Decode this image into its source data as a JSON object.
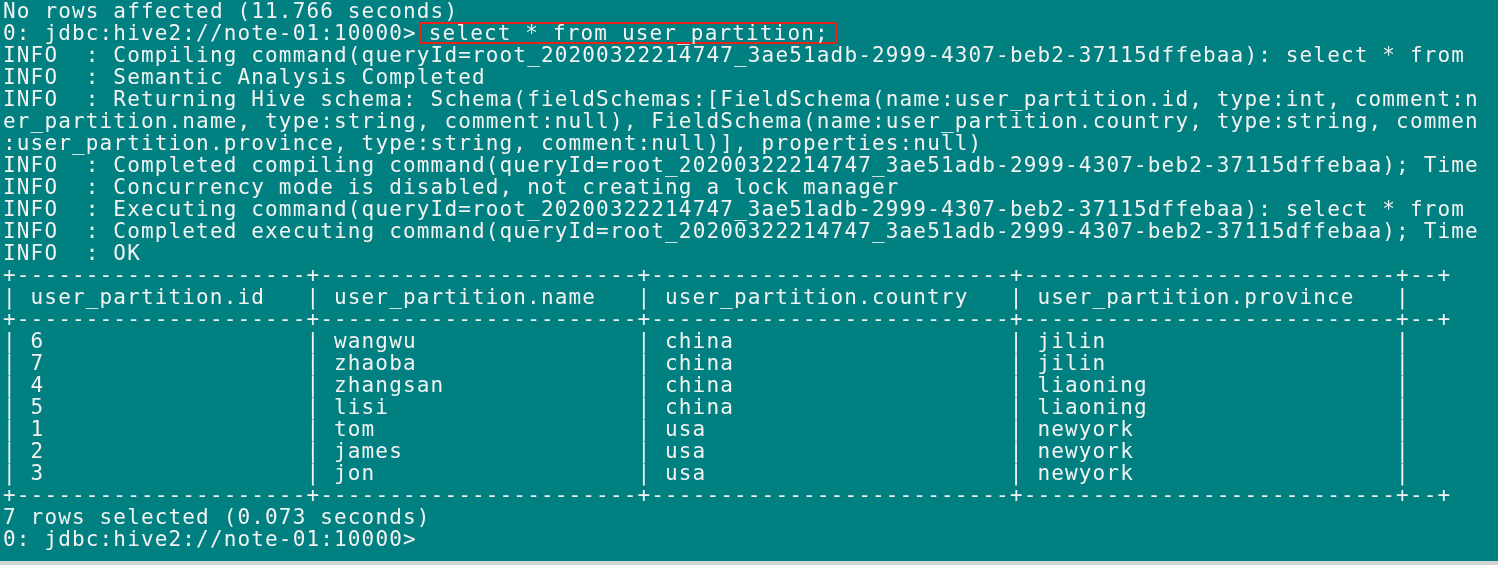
{
  "terminal": {
    "lines": [
      {
        "kind": "output",
        "text": "No rows affected (11.766 seconds)"
      },
      {
        "kind": "prompt",
        "prompt": "0: jdbc:hive2://note-01:10000>",
        "command": "select * from user_partition;",
        "highlighted": true
      },
      {
        "kind": "output",
        "text": "INFO  : Compiling command(queryId=root_20200322214747_3ae51adb-2999-4307-beb2-37115dffebaa): select * from"
      },
      {
        "kind": "output",
        "text": "INFO  : Semantic Analysis Completed"
      },
      {
        "kind": "output",
        "text": "INFO  : Returning Hive schema: Schema(fieldSchemas:[FieldSchema(name:user_partition.id, type:int, comment:n"
      },
      {
        "kind": "output",
        "text": "er_partition.name, type:string, comment:null), FieldSchema(name:user_partition.country, type:string, commen"
      },
      {
        "kind": "output",
        "text": ":user_partition.province, type:string, comment:null)], properties:null)"
      },
      {
        "kind": "output",
        "text": "INFO  : Completed compiling command(queryId=root_20200322214747_3ae51adb-2999-4307-beb2-37115dffebaa); Time"
      },
      {
        "kind": "output",
        "text": "INFO  : Concurrency mode is disabled, not creating a lock manager"
      },
      {
        "kind": "output",
        "text": "INFO  : Executing command(queryId=root_20200322214747_3ae51adb-2999-4307-beb2-37115dffebaa): select * from"
      },
      {
        "kind": "output",
        "text": "INFO  : Completed executing command(queryId=root_20200322214747_3ae51adb-2999-4307-beb2-37115dffebaa); Time"
      },
      {
        "kind": "output",
        "text": "INFO  : OK"
      },
      {
        "kind": "table",
        "border": "+---------------------+-----------------------+--------------------------+---------------------------+--+",
        "separator": "|",
        "columns": [
          "user_partition.id",
          "user_partition.name",
          "user_partition.country",
          "user_partition.province"
        ],
        "rows": [
          [
            "6",
            "wangwu",
            "china",
            "jilin"
          ],
          [
            "7",
            "zhaoba",
            "china",
            "jilin"
          ],
          [
            "4",
            "zhangsan",
            "china",
            "liaoning"
          ],
          [
            "5",
            "lisi",
            "china",
            "liaoning"
          ],
          [
            "1",
            "tom",
            "usa",
            "newyork"
          ],
          [
            "2",
            "james",
            "usa",
            "newyork"
          ],
          [
            "3",
            "jon",
            "usa",
            "newyork"
          ]
        ]
      },
      {
        "kind": "output",
        "text": "7 rows selected (0.073 seconds)"
      },
      {
        "kind": "prompt",
        "prompt": "0: jdbc:hive2://note-01:10000>"
      }
    ]
  }
}
